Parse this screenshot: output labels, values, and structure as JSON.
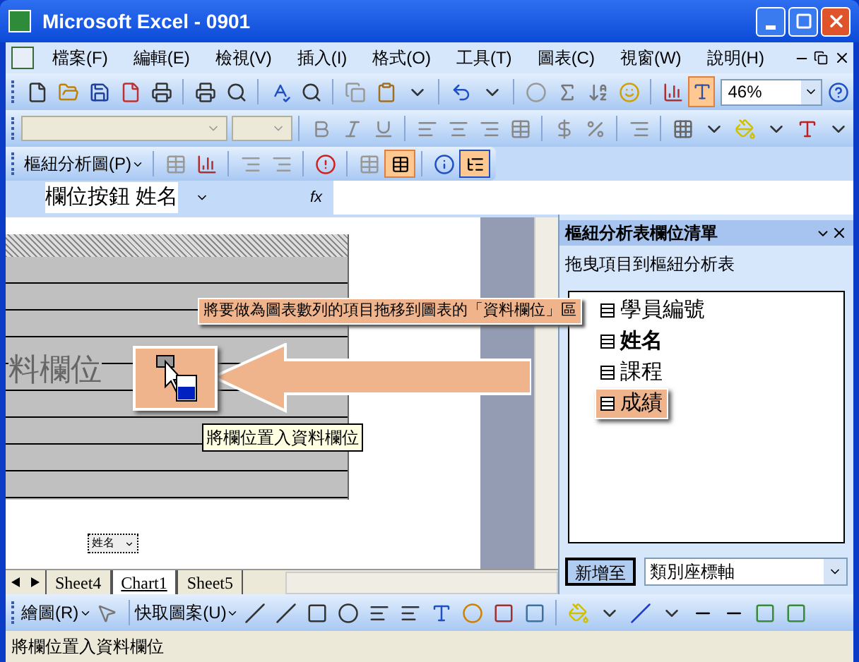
{
  "window": {
    "title": "Microsoft Excel - 0901"
  },
  "menu": [
    {
      "label": "檔案(F)"
    },
    {
      "label": "編輯(E)"
    },
    {
      "label": "檢視(V)"
    },
    {
      "label": "插入(I)"
    },
    {
      "label": "格式(O)"
    },
    {
      "label": "工具(T)"
    },
    {
      "label": "圖表(C)"
    },
    {
      "label": "視窗(W)"
    },
    {
      "label": "說明(H)"
    }
  ],
  "standard_toolbar": {
    "zoom": "46%"
  },
  "pivot_toolbar": {
    "label": "樞紐分析圖(P)"
  },
  "formula_bar": {
    "name_box": "欄位按鈕 姓名",
    "fx": "fx"
  },
  "chart": {
    "drop_hint": "料欄位",
    "field_button": "姓名"
  },
  "annotation": {
    "callout": "將要做為圖表數列的項目拖移到圖表的「資料欄位」區",
    "tooltip": "將欄位置入資料欄位"
  },
  "task_pane": {
    "title": "樞紐分析表欄位清單",
    "subtitle": "拖曳項目到樞紐分析表",
    "fields": [
      {
        "label": "學員編號",
        "selected": false,
        "highlighted": false
      },
      {
        "label": "姓名",
        "selected": true,
        "highlighted": false
      },
      {
        "label": "課程",
        "selected": false,
        "highlighted": false
      },
      {
        "label": "成績",
        "selected": false,
        "highlighted": true
      }
    ],
    "add_button": "新增至",
    "area_dropdown": "類別座標軸"
  },
  "sheet_tabs": [
    {
      "label": "Sheet4",
      "selected": false
    },
    {
      "label": "Chart1",
      "selected": true
    },
    {
      "label": "Sheet5",
      "selected": false
    }
  ],
  "drawing_toolbar": {
    "draw_menu": "繪圖(R)",
    "autoshapes_menu": "快取圖案(U)"
  },
  "status_bar": {
    "text": "將欄位置入資料欄位"
  }
}
